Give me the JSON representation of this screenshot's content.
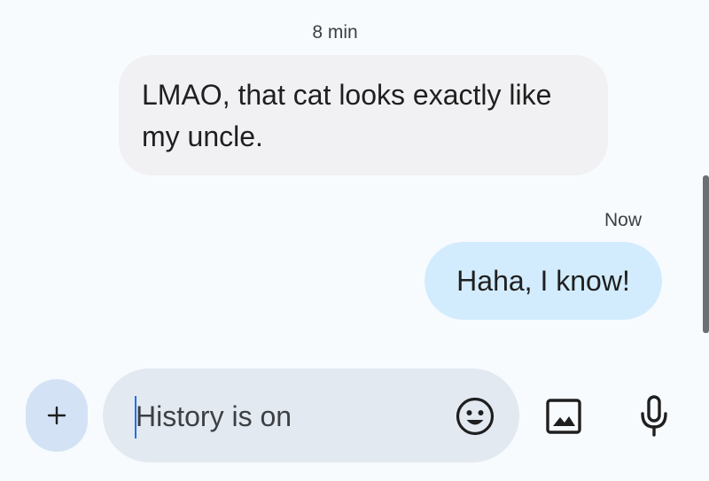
{
  "thread": {
    "received_timestamp": "8 min",
    "received_message": "LMAO, that cat looks exactly like my uncle.",
    "sent_timestamp": "Now",
    "sent_message": "Haha, I know!"
  },
  "compose": {
    "placeholder": "History is on",
    "value": "",
    "icons": {
      "attach": "plus-icon",
      "emoji": "emoji-icon",
      "gallery": "image-icon",
      "voice": "mic-icon"
    }
  },
  "colors": {
    "background": "#f8fbfe",
    "received_bubble": "#f1f0f3",
    "sent_bubble": "#d3ecfd",
    "compose_pill": "#e3e9f1",
    "plus_button": "#d3e3f5",
    "icon": "#1f1f1f",
    "caret": "#1a73e8"
  }
}
